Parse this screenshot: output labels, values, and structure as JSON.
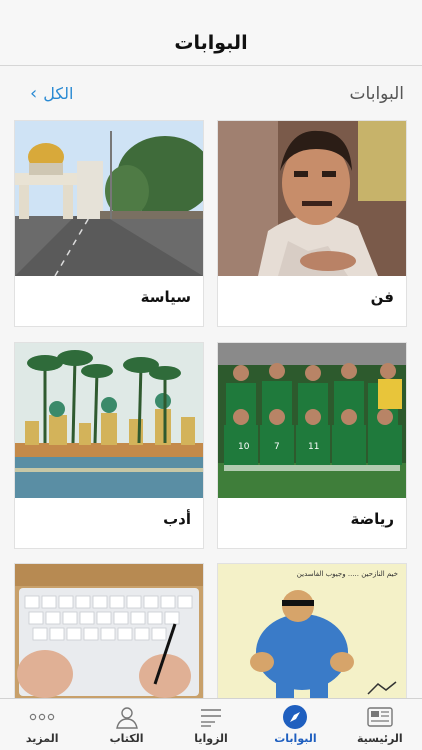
{
  "navbar": {
    "title": "البوابات"
  },
  "section": {
    "title": "البوابات",
    "see_all": "الكل"
  },
  "cards": [
    {
      "label": "فن"
    },
    {
      "label": "سياسة"
    },
    {
      "label": "رياضة"
    },
    {
      "label": "أدب"
    },
    {
      "label": ""
    },
    {
      "label": ""
    }
  ],
  "cartoon_text": "خيم النازحين ..... وجيوب الفاسدين",
  "tabs": [
    {
      "label": "الرئيسية",
      "icon": "newspaper-icon"
    },
    {
      "label": "البوابات",
      "icon": "compass-icon",
      "active": true
    },
    {
      "label": "الزوايا",
      "icon": "list-icon"
    },
    {
      "label": "الكتاب",
      "icon": "person-icon"
    },
    {
      "label": "المزيد",
      "icon": "more-dots-icon"
    }
  ],
  "colors": {
    "accent": "#2a8ad3",
    "active_tab": "#1f5fbf"
  }
}
